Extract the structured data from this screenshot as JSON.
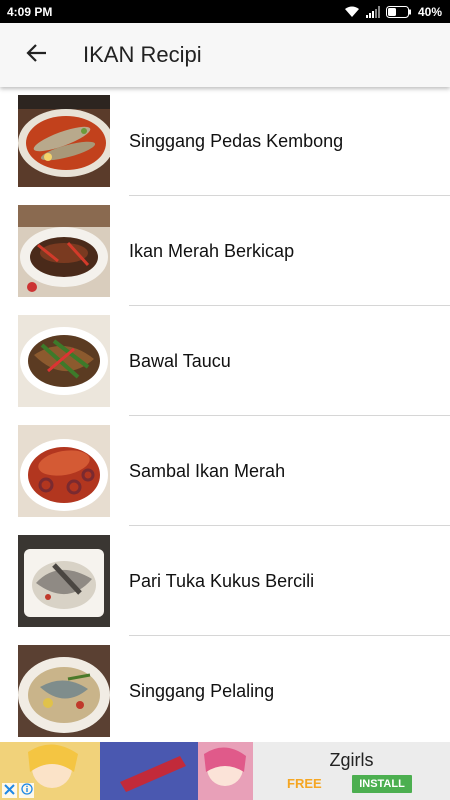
{
  "status_bar": {
    "time": "4:09 PM",
    "battery": "40%"
  },
  "app_bar": {
    "title": "IKAN Recipi"
  },
  "recipes": [
    {
      "label": "Singgang Pedas Kembong"
    },
    {
      "label": "Ikan Merah Berkicap"
    },
    {
      "label": "Bawal Taucu"
    },
    {
      "label": "Sambal Ikan Merah"
    },
    {
      "label": "Pari Tuka Kukus Bercili"
    },
    {
      "label": "Singgang Pelaling"
    }
  ],
  "ad": {
    "title": "Zgirls",
    "price": "FREE",
    "install_label": "INSTALL"
  },
  "colors": {
    "status_bar": "#000000",
    "app_bar": "#f7f7f7",
    "install_button": "#4caf50",
    "free_text": "#f5a623"
  }
}
